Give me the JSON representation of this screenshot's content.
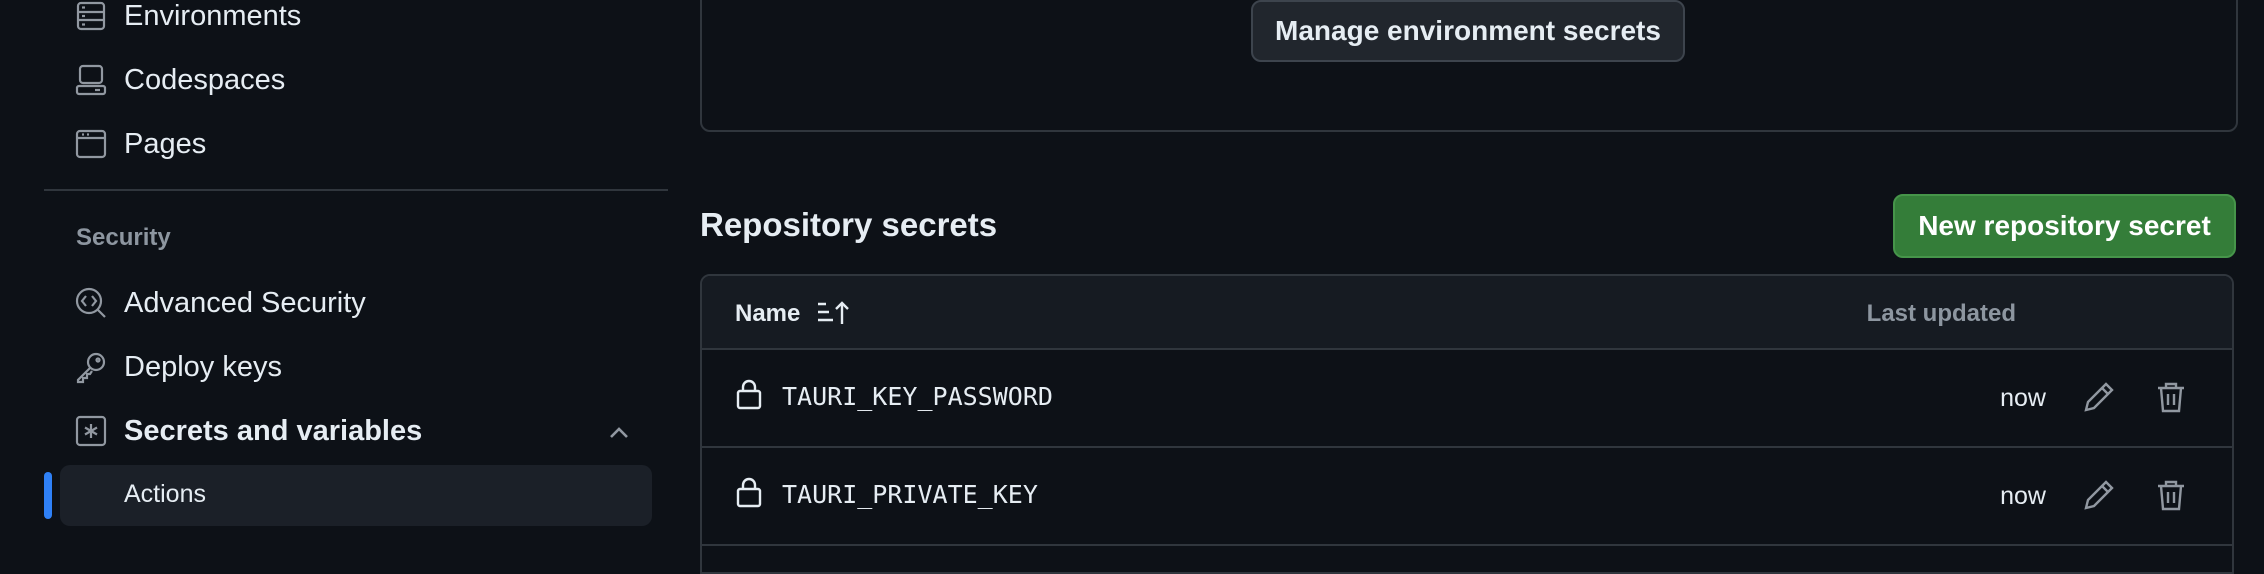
{
  "sidebar": {
    "items": [
      {
        "label": "Environments",
        "icon": "server-icon"
      },
      {
        "label": "Codespaces",
        "icon": "codespaces-icon"
      },
      {
        "label": "Pages",
        "icon": "browser-icon"
      }
    ],
    "security_heading": "Security",
    "security_items": [
      {
        "label": "Advanced Security",
        "icon": "codescan-icon"
      },
      {
        "label": "Deploy keys",
        "icon": "key-icon"
      },
      {
        "label": "Secrets and variables",
        "icon": "asterisk-icon"
      }
    ],
    "active_subitem": "Actions"
  },
  "environment": {
    "manage_button": "Manage environment secrets"
  },
  "repository_secrets": {
    "title": "Repository secrets",
    "new_button": "New repository secret",
    "columns": {
      "name": "Name",
      "last_updated": "Last updated"
    },
    "rows": [
      {
        "name": "TAURI_KEY_PASSWORD",
        "updated": "now"
      },
      {
        "name": "TAURI_PRIVATE_KEY",
        "updated": "now"
      }
    ]
  },
  "colors": {
    "background": "#0d1117",
    "border": "#30363d",
    "accent_blue": "#2f81f7",
    "primary_green": "#347d39"
  }
}
